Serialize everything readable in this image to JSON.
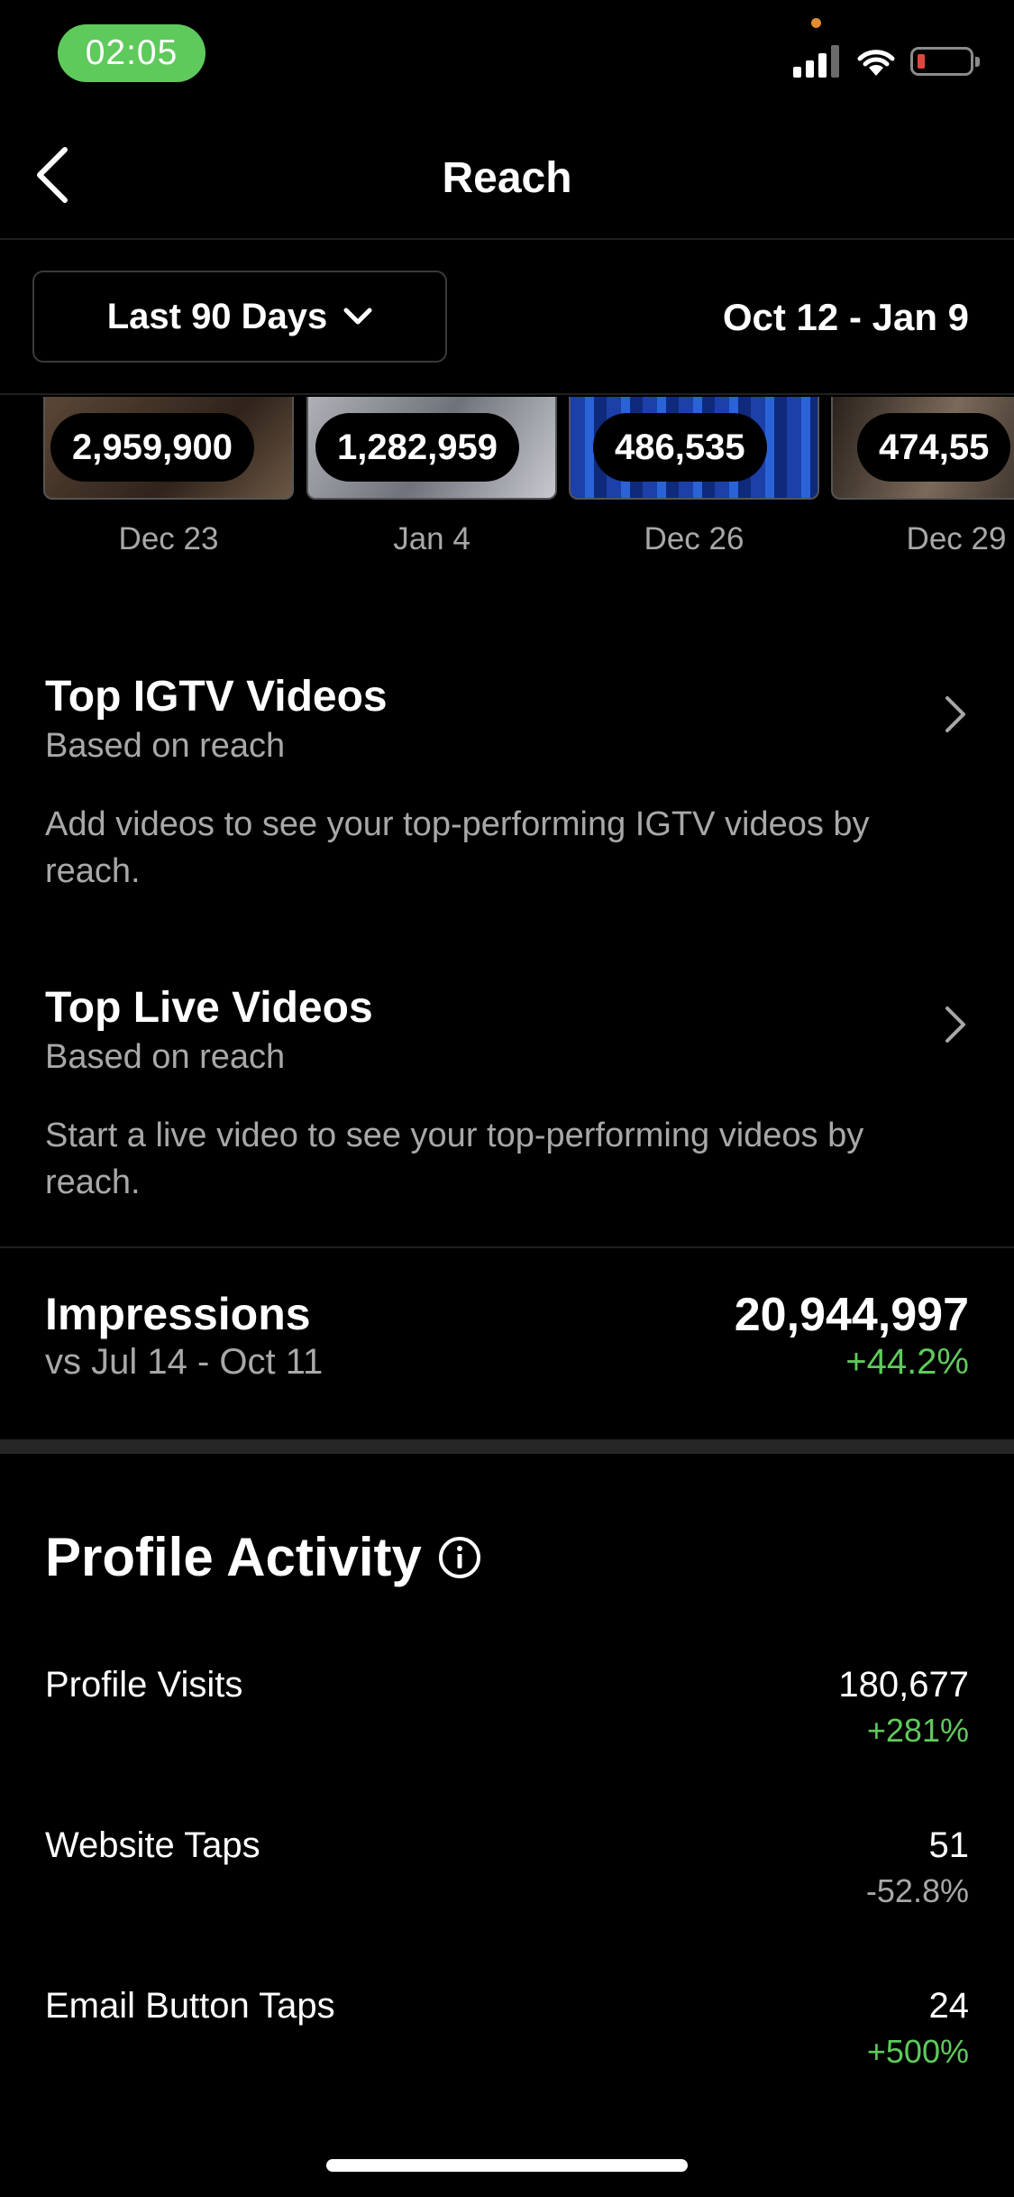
{
  "status_bar": {
    "time": "02:05"
  },
  "header": {
    "title": "Reach"
  },
  "filter": {
    "range_label": "Last 90 Days",
    "date_range": "Oct 12 - Jan 9"
  },
  "top_posts": [
    {
      "value": "2,959,900",
      "date": "Dec 23"
    },
    {
      "value": "1,282,959",
      "date": "Jan 4"
    },
    {
      "value": "486,535",
      "date": "Dec 26"
    },
    {
      "value": "474,55",
      "date": "Dec 29"
    }
  ],
  "igtv": {
    "title": "Top IGTV Videos",
    "subtitle": "Based on reach",
    "description": "Add videos to see your top-performing IGTV videos by reach."
  },
  "live": {
    "title": "Top Live Videos",
    "subtitle": "Based on reach",
    "description": "Start a live video to see your top-performing videos by reach."
  },
  "impressions": {
    "title": "Impressions",
    "comparison": "vs Jul 14 - Oct 11",
    "value": "20,944,997",
    "change": "+44.2%"
  },
  "profile_activity": {
    "title": "Profile Activity",
    "rows": [
      {
        "label": "Profile Visits",
        "value": "180,677",
        "change": "+281%"
      },
      {
        "label": "Website Taps",
        "value": "51",
        "change": "-52.8%"
      },
      {
        "label": "Email Button Taps",
        "value": "24",
        "change": "+500%"
      }
    ]
  },
  "colors": {
    "positive": "#5fca5c",
    "muted": "#a8a8a8",
    "time_pill": "#5fca5c"
  }
}
